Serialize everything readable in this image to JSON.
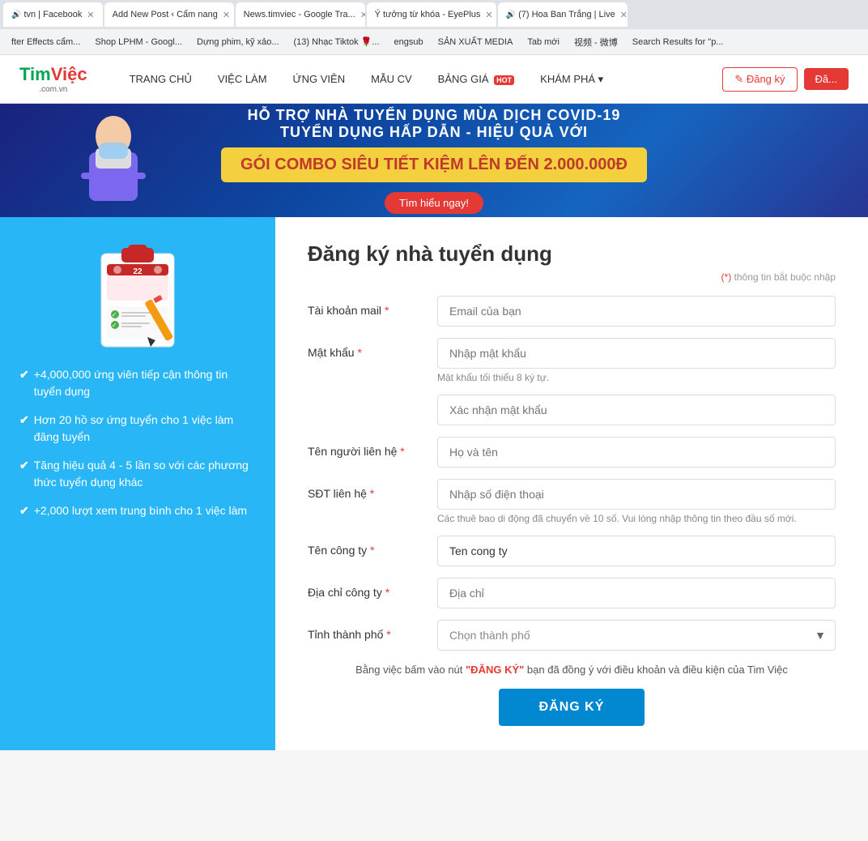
{
  "browser": {
    "tabs": [
      {
        "id": "tab1",
        "label": "tvn | Facebook",
        "active": false,
        "has_audio": true
      },
      {
        "id": "tab2",
        "label": "Add New Post ‹ Cẩm nang",
        "active": false
      },
      {
        "id": "tab3",
        "label": "News.timviec - Google Tra...",
        "active": true
      },
      {
        "id": "tab4",
        "label": "Ý tưởng từ khóa - EyePlus",
        "active": false
      },
      {
        "id": "tab5",
        "label": "(7) Hoa Ban Trắng | Live",
        "active": false,
        "has_audio": true
      }
    ]
  },
  "bookmarks": [
    {
      "label": "fter Effects cẩm..."
    },
    {
      "label": "Shop LPHM - Googl..."
    },
    {
      "label": "Dựng phim, kỹ xảo..."
    },
    {
      "label": "(13) Nhạc Tiktok 🌹..."
    },
    {
      "label": "engsub"
    },
    {
      "label": "SẢN XUẤT MEDIA"
    },
    {
      "label": "Tab mới"
    },
    {
      "label": "视频 - 微博"
    },
    {
      "label": "Search Results for \"p..."
    }
  ],
  "header": {
    "logo_tim": "Tim",
    "logo_viec": "Việc",
    "logo_dot": ".com.vn",
    "nav_items": [
      {
        "label": "TRANG CHỦ"
      },
      {
        "label": "VIỆC LÀM"
      },
      {
        "label": "ỨNG VIÊN"
      },
      {
        "label": "MẪU CV"
      },
      {
        "label": "BẢNG GIÁ",
        "badge": "HOT"
      },
      {
        "label": "KHÁM PHÁ ▾"
      }
    ],
    "btn_dangky": "✎ Đăng ký",
    "btn_dangnhap": "Đă..."
  },
  "banner": {
    "line1": "HỖ TRỢ NHÀ TUYỂN DỤNG MÙA DỊCH COVID-19",
    "line2": "TUYỂN DỤNG HẤP DẪN - HIỆU QUẢ VỚI",
    "promo": "GÓI COMBO SIÊU TIẾT KIỆM LÊN ĐẾN 2.000.000Đ",
    "cta": "Tìm hiểu ngay!"
  },
  "left_panel": {
    "features": [
      "+4,000,000 ứng viên tiếp cận thông tin tuyển dụng",
      "Hơn 20 hồ sơ ứng tuyển cho 1 việc làm đăng tuyển",
      "Tăng hiệu quả 4 - 5 lần so với các phương thức tuyển dụng khác",
      "+2,000 lượt xem trung bình cho 1 việc làm"
    ]
  },
  "form": {
    "title": "Đăng ký nhà tuyển dụng",
    "required_note": "(*) thông tin bắt buộc nhập",
    "fields": [
      {
        "label": "Tài khoản mail",
        "required": true,
        "placeholder": "Email của bạn",
        "type": "email",
        "name": "email"
      },
      {
        "label": "Mật khẩu",
        "required": true,
        "placeholder": "Nhập mật khẩu",
        "hint": "Mật khẩu tối thiểu 8 ký tự.",
        "type": "password",
        "name": "password"
      },
      {
        "label": "",
        "required": false,
        "placeholder": "Xác nhận mật khẩu",
        "type": "password",
        "name": "confirm_password"
      },
      {
        "label": "Tên người liên hệ",
        "required": true,
        "placeholder": "Họ và tên",
        "type": "text",
        "name": "fullname"
      },
      {
        "label": "SĐT liên hệ",
        "required": true,
        "placeholder": "Nhập số điện thoại",
        "hint": "Các thuê bao di động đã chuyển về 10 số. Vui lòng nhập thông tin theo đầu số mới.",
        "type": "tel",
        "name": "phone"
      },
      {
        "label": "Tên công ty",
        "required": true,
        "placeholder": "Tên công ty",
        "current_value": "Ten cong ty",
        "type": "text",
        "name": "company_name"
      },
      {
        "label": "Địa chỉ công ty",
        "required": true,
        "placeholder": "Địa chỉ",
        "type": "text",
        "name": "company_address"
      },
      {
        "label": "Tỉnh thành phố",
        "required": true,
        "placeholder": "Chọn thành phố",
        "type": "select",
        "name": "city"
      }
    ],
    "terms_text_before": "Bằng việc bấm vào nút ",
    "terms_link": "\"ĐĂNG KÝ\"",
    "terms_text_after": " bạn đã đồng ý với điều khoản và điều kiện của Tim Việc",
    "submit_label": "ĐĂNG KÝ"
  }
}
